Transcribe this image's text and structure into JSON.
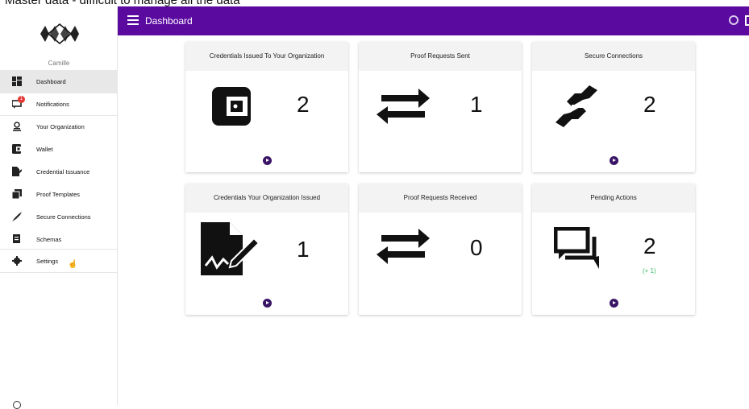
{
  "caption": "Master data - difficult to manage all the data",
  "topbar": {
    "title": "Dashboard"
  },
  "sidebar": {
    "username": "Camille",
    "items": [
      {
        "label": "Dashboard",
        "icon": "dashboard-icon",
        "active": true
      },
      {
        "label": "Notifications",
        "icon": "notifications-icon",
        "badge": "1"
      },
      {
        "label": "Your Organization",
        "icon": "organization-icon"
      },
      {
        "label": "Wallet",
        "icon": "wallet-icon"
      },
      {
        "label": "Credential Issuance",
        "icon": "credential-issuance-icon"
      },
      {
        "label": "Proof Templates",
        "icon": "proof-templates-icon"
      },
      {
        "label": "Secure Connections",
        "icon": "secure-connections-icon"
      },
      {
        "label": "Schemas",
        "icon": "schemas-icon"
      },
      {
        "label": "Settings",
        "icon": "gear-icon"
      }
    ]
  },
  "cards": [
    {
      "title": "Credentials Issued To Your Organization",
      "value": "2",
      "icon": "wallet-icon"
    },
    {
      "title": "Proof Requests Sent",
      "value": "1",
      "icon": "exchange-icon"
    },
    {
      "title": "Secure Connections",
      "value": "2",
      "icon": "handshake-icon"
    },
    {
      "title": "Credentials Your Organization Issued",
      "value": "1",
      "icon": "signed-document-icon"
    },
    {
      "title": "Proof Requests Received",
      "value": "0",
      "icon": "exchange-icon"
    },
    {
      "title": "Pending Actions",
      "value": "2",
      "sub": "(+ 1)",
      "icon": "chat-icon"
    }
  ],
  "colors": {
    "topbar": "#5b0aa0",
    "accent_button": "#3a1466",
    "positive": "#3bbf6a"
  }
}
